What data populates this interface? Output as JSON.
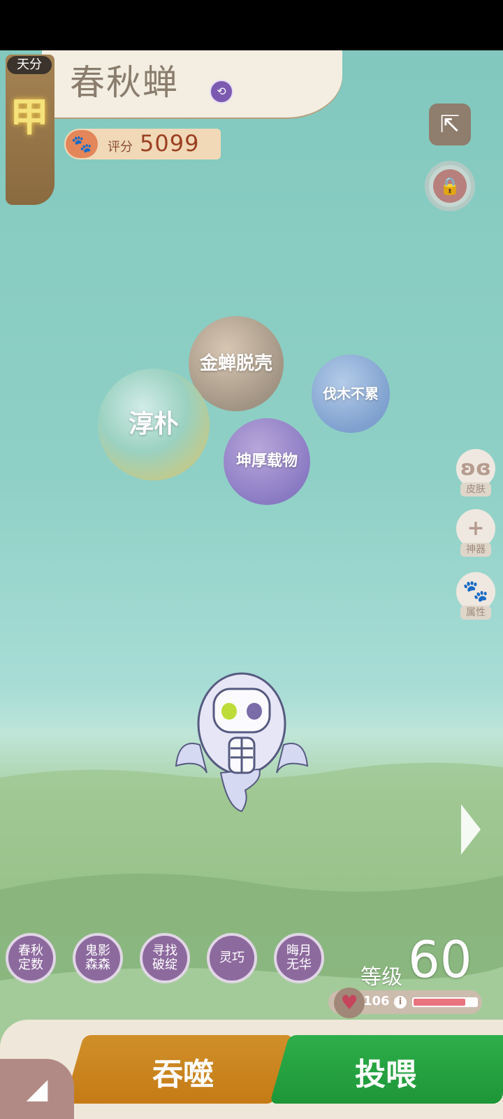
{
  "pet": {
    "tier_label": "天分",
    "tier_value": "甲",
    "name": "春秋蝉",
    "score_label": "评分",
    "score_value": "5099"
  },
  "tags": [
    "金蝉脱壳",
    "淳朴",
    "伐木不累",
    "坤厚载物"
  ],
  "side_menu": [
    "皮肤",
    "神器",
    "属性"
  ],
  "skills": [
    {
      "l1": "春秋",
      "l2": "定数"
    },
    {
      "l1": "鬼影",
      "l2": "森森"
    },
    {
      "l1": "寻找",
      "l2": "破绽"
    },
    {
      "l1": "灵巧",
      "l2": ""
    },
    {
      "l1": "晦月",
      "l2": "无华"
    }
  ],
  "level": {
    "label": "等级",
    "value": "60"
  },
  "hp": {
    "value": "106",
    "bar_fraction": 0.82
  },
  "actions": {
    "devour": "吞噬",
    "feed": "投喂"
  },
  "icons": [
    "share-icon",
    "lock-icon",
    "paw-icon",
    "butterfly-icon",
    "plus-icon",
    "info-icon",
    "heart-icon",
    "next-arrow-icon"
  ],
  "colors": {
    "tier_gold": "#f6e27b",
    "score_red": "#9b3f22",
    "devour_orange": "#c57b15",
    "feed_green": "#1e9638",
    "skill_purple": "#8d6a9e"
  }
}
